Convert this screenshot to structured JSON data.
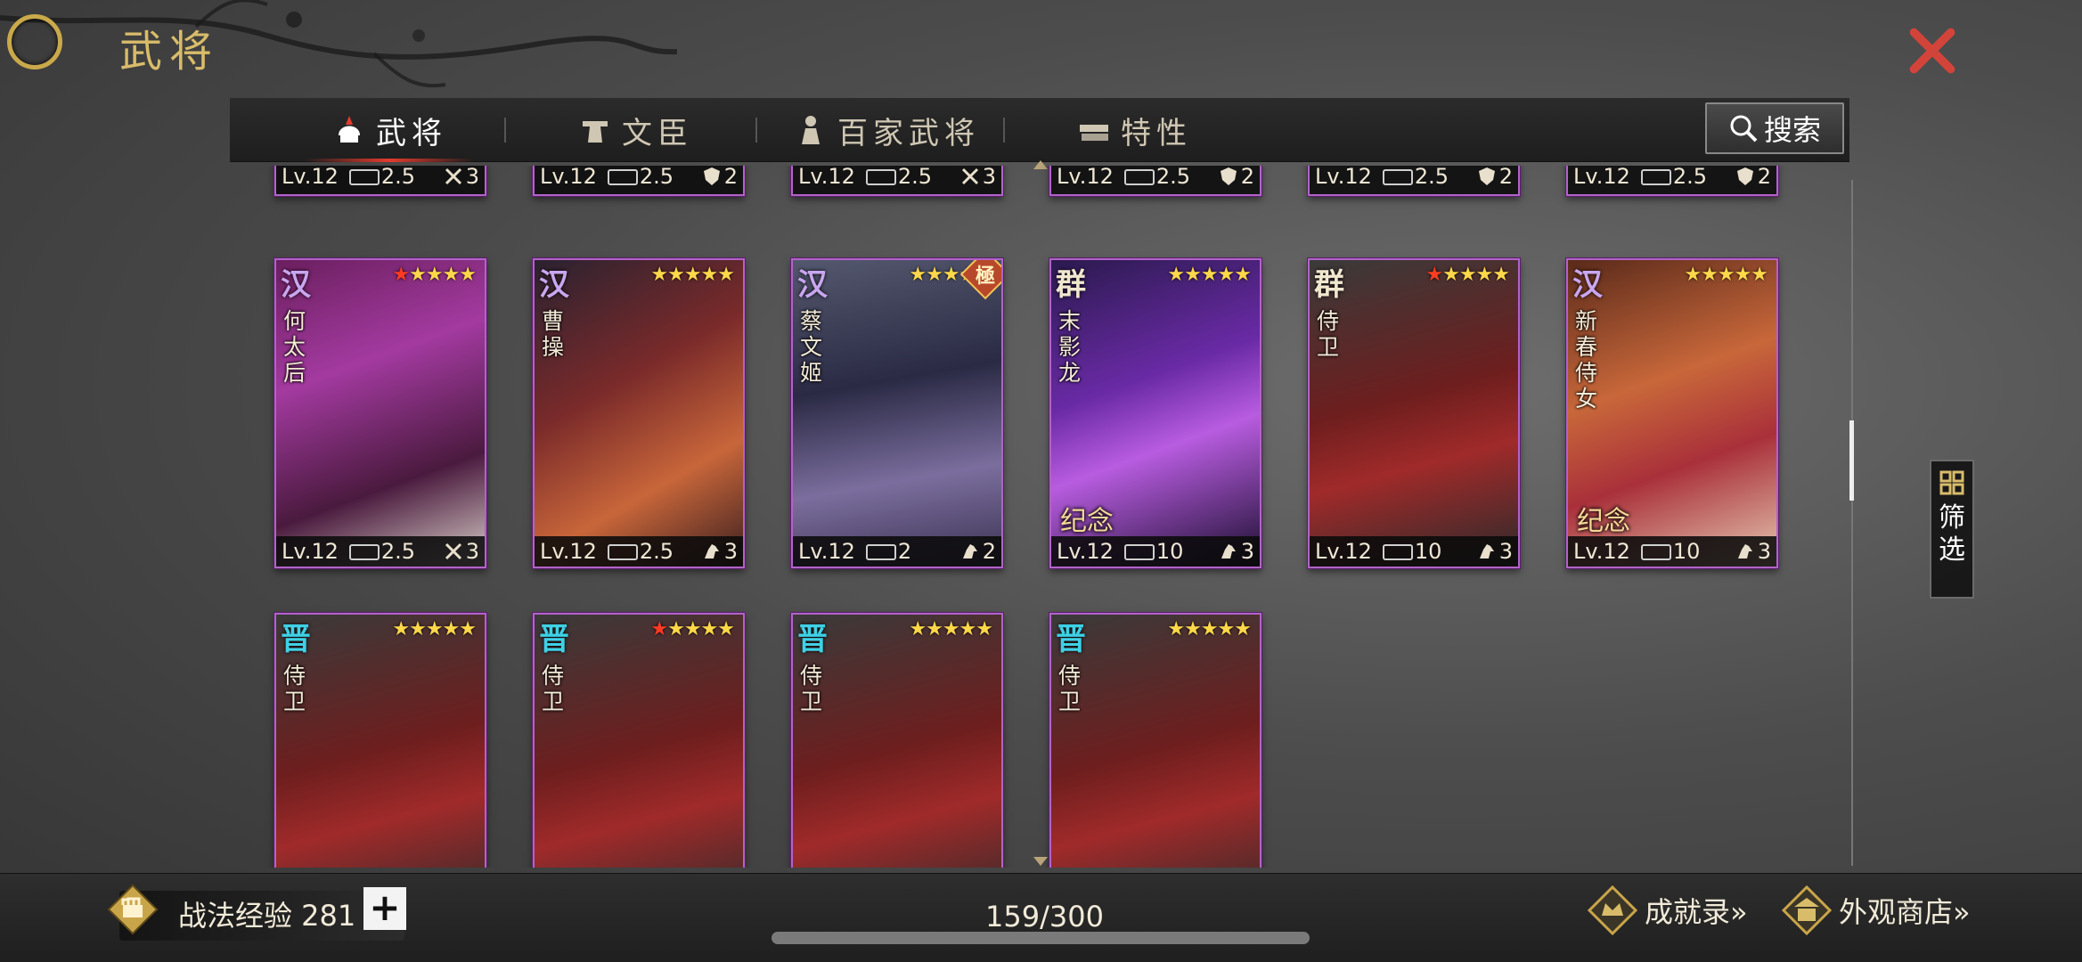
{
  "page": {
    "title": "武将"
  },
  "tabs": [
    {
      "label": "武将",
      "icon": "helmet-icon",
      "active": true
    },
    {
      "label": "文臣",
      "icon": "scholar-hat-icon",
      "active": false
    },
    {
      "label": "百家武将",
      "icon": "robed-figure-icon",
      "active": false
    },
    {
      "label": "特性",
      "icon": "scroll-books-icon",
      "active": false
    }
  ],
  "search": {
    "label": "搜索"
  },
  "filter": {
    "label": "筛选"
  },
  "partial_row": [
    {
      "level": "Lv.12",
      "cost": "2.5",
      "troop": "3",
      "troop_icon": "crossed-weapons-icon"
    },
    {
      "level": "Lv.12",
      "cost": "2.5",
      "troop": "2",
      "troop_icon": "shield-icon"
    },
    {
      "level": "Lv.12",
      "cost": "2.5",
      "troop": "3",
      "troop_icon": "crossed-weapons-icon"
    },
    {
      "level": "Lv.12",
      "cost": "2.5",
      "troop": "2",
      "troop_icon": "shield-icon"
    },
    {
      "level": "Lv.12",
      "cost": "2.5",
      "troop": "2",
      "troop_icon": "shield-icon"
    },
    {
      "level": "Lv.12",
      "cost": "2.5",
      "troop": "2",
      "troop_icon": "shield-icon"
    }
  ],
  "cards": [
    {
      "faction": "汉",
      "name": "何太后",
      "stars": 5,
      "red_stars": 1,
      "level": "Lv.12",
      "cost": "2.5",
      "troop": "3",
      "troop_icon": "crossed-weapons-icon",
      "badge": "",
      "memorial": ""
    },
    {
      "faction": "汉",
      "name": "曹操",
      "stars": 5,
      "red_stars": 0,
      "level": "Lv.12",
      "cost": "2.5",
      "troop": "3",
      "troop_icon": "horse-icon",
      "badge": "",
      "memorial": ""
    },
    {
      "faction": "汉",
      "name": "蔡文姬",
      "stars": 5,
      "red_stars": 0,
      "level": "Lv.12",
      "cost": "2",
      "troop": "2",
      "troop_icon": "horse-icon",
      "badge": "極",
      "memorial": ""
    },
    {
      "faction": "群",
      "name": "末影龙",
      "stars": 5,
      "red_stars": 0,
      "level": "Lv.12",
      "cost": "10",
      "troop": "3",
      "troop_icon": "horse-icon",
      "badge": "",
      "memorial": "纪念"
    },
    {
      "faction": "群",
      "name": "侍卫",
      "stars": 5,
      "red_stars": 1,
      "level": "Lv.12",
      "cost": "10",
      "troop": "3",
      "troop_icon": "horse-icon",
      "badge": "",
      "memorial": ""
    },
    {
      "faction": "汉",
      "name": "新春侍女",
      "stars": 5,
      "red_stars": 0,
      "level": "Lv.12",
      "cost": "10",
      "troop": "3",
      "troop_icon": "horse-icon",
      "badge": "",
      "memorial": "纪念"
    },
    {
      "faction": "晋",
      "name": "侍卫",
      "stars": 5,
      "red_stars": 0
    },
    {
      "faction": "晋",
      "name": "侍卫",
      "stars": 5,
      "red_stars": 1
    },
    {
      "faction": "晋",
      "name": "侍卫",
      "stars": 5,
      "red_stars": 0
    },
    {
      "faction": "晋",
      "name": "侍卫",
      "stars": 5,
      "red_stars": 0
    }
  ],
  "colors": {
    "faction_han": "#c9a6f0",
    "faction_qun": "#f1e7cf",
    "faction_jin": "#3fd1e6",
    "card_border": "#b163c8",
    "star": "#ffd84a",
    "star_red": "#ff3b22"
  },
  "bottom": {
    "exp_label": "战法经验 281",
    "plus": "+",
    "count": "159/300",
    "achievements": "成就录»",
    "shop": "外观商店»"
  }
}
